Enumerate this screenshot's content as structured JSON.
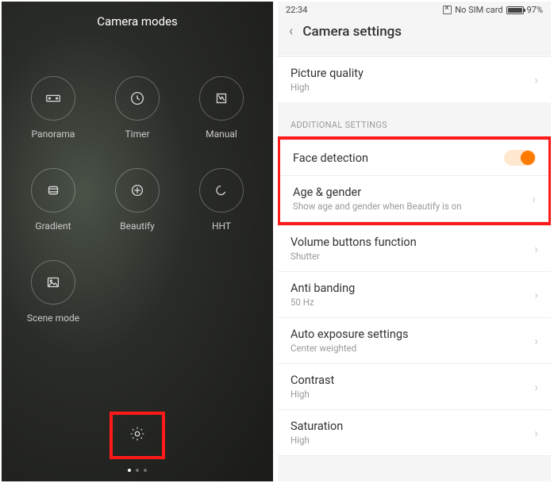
{
  "left": {
    "title": "Camera modes",
    "modes": [
      {
        "label": "Panorama",
        "icon": "panorama"
      },
      {
        "label": "Timer",
        "icon": "timer"
      },
      {
        "label": "Manual",
        "icon": "manual"
      },
      {
        "label": "Gradient",
        "icon": "gradient"
      },
      {
        "label": "Beautify",
        "icon": "beautify"
      },
      {
        "label": "HHT",
        "icon": "hht"
      },
      {
        "label": "Scene mode",
        "icon": "scene"
      }
    ],
    "page_dots": 3,
    "active_dot": 0
  },
  "right": {
    "status": {
      "time": "22:34",
      "sim": "No SIM card",
      "battery": "97%"
    },
    "title": "Camera settings",
    "top_item": {
      "title": "Picture quality",
      "sub": "High"
    },
    "section_header": "ADDITIONAL SETTINGS",
    "highlight": {
      "face": {
        "title": "Face detection",
        "toggle": true
      },
      "age": {
        "title": "Age & gender",
        "sub": "Show age and gender when Beautify is on"
      }
    },
    "rest": [
      {
        "title": "Volume buttons function",
        "sub": "Shutter"
      },
      {
        "title": "Anti banding",
        "sub": "50 Hz"
      },
      {
        "title": "Auto exposure settings",
        "sub": "Center weighted"
      },
      {
        "title": "Contrast",
        "sub": "High"
      },
      {
        "title": "Saturation",
        "sub": "High"
      }
    ]
  }
}
